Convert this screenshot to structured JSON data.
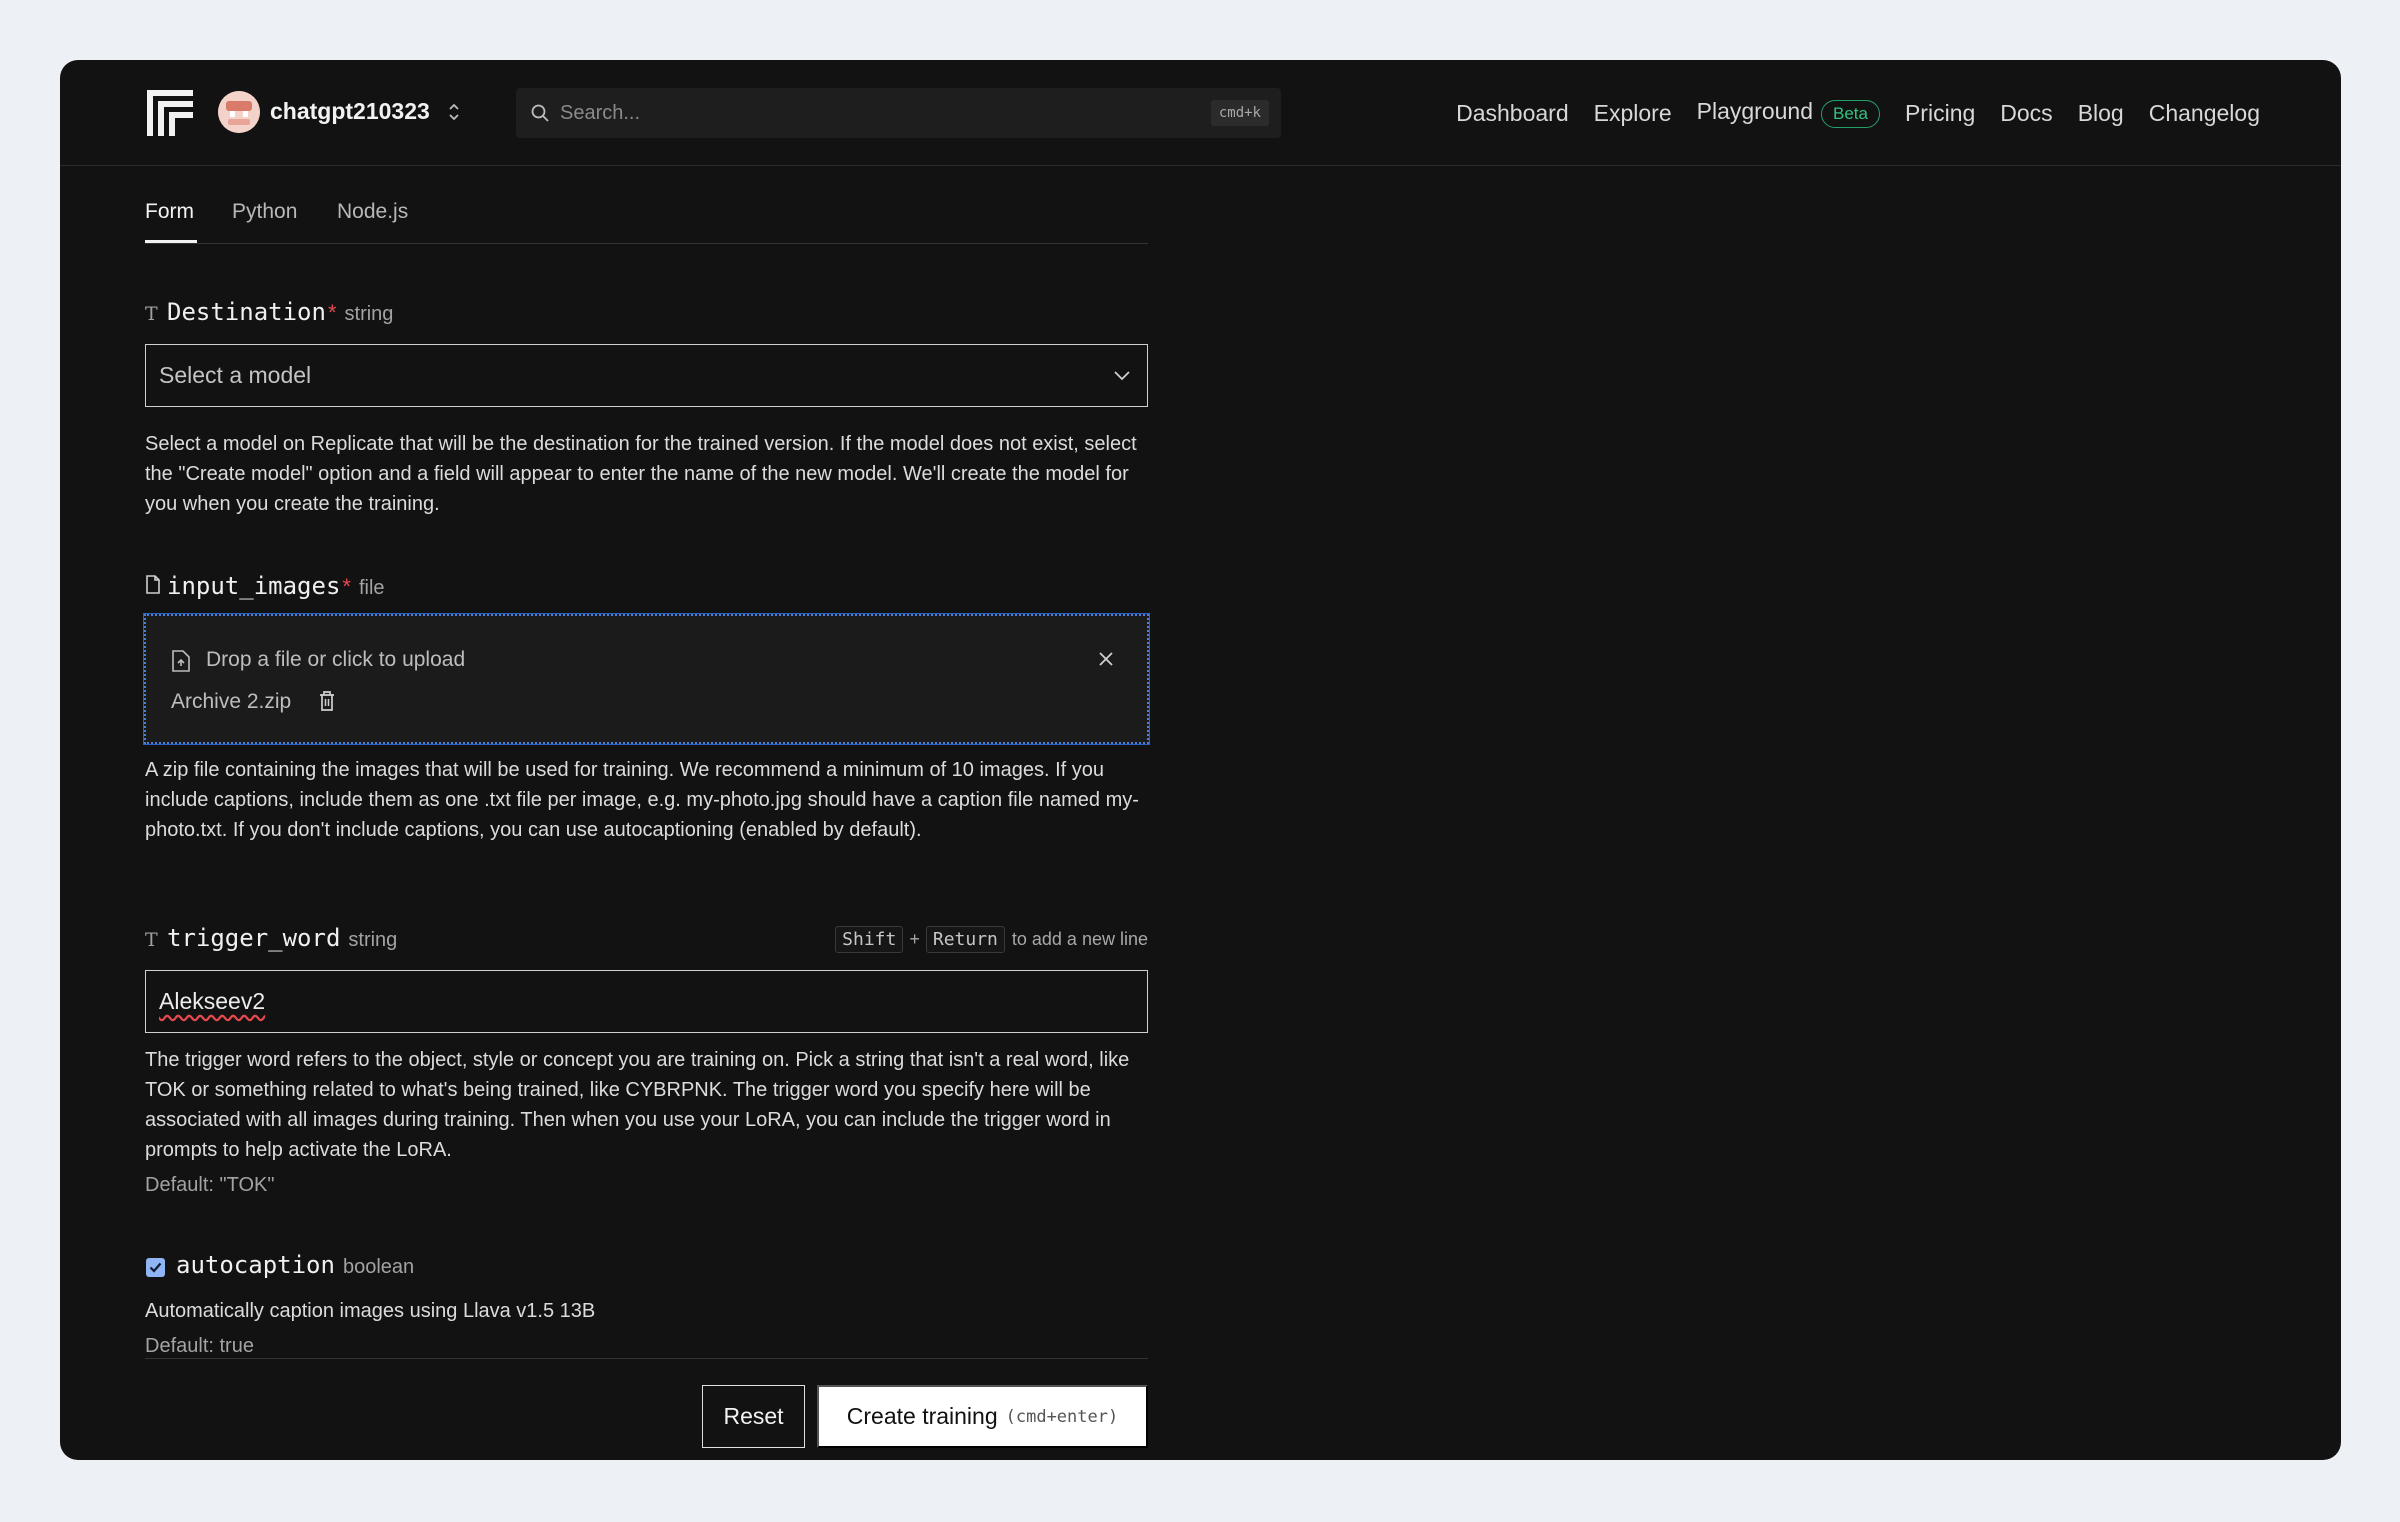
{
  "header": {
    "username": "chatgpt210323",
    "search_placeholder": "Search...",
    "search_shortcut": "cmd+k",
    "nav": {
      "dashboard": "Dashboard",
      "explore": "Explore",
      "playground": "Playground",
      "playground_badge": "Beta",
      "pricing": "Pricing",
      "docs": "Docs",
      "blog": "Blog",
      "changelog": "Changelog"
    }
  },
  "tabs": {
    "form": "Form",
    "python": "Python",
    "nodejs": "Node.js",
    "active": "Form"
  },
  "fields": {
    "destination": {
      "name": "Destination",
      "required_mark": "*",
      "type": "string",
      "type_glyph": "T",
      "placeholder": "Select a model",
      "description": "Select a model on Replicate that will be the destination for the trained version. If the model does not exist, select the \"Create model\" option and a field will appear to enter the name of the new model. We'll create the model for you when you create the training."
    },
    "input_images": {
      "name": "input_images",
      "required_mark": "*",
      "type": "file",
      "upload_prompt": "Drop a file or click to upload",
      "file_name": "Archive 2.zip",
      "description": "A zip file containing the images that will be used for training. We recommend a minimum of 10 images. If you include captions, include them as one .txt file per image, e.g. my-photo.jpg should have a caption file named my-photo.txt. If you don't include captions, you can use autocaptioning (enabled by default)."
    },
    "trigger_word": {
      "name": "trigger_word",
      "type": "string",
      "type_glyph": "T",
      "hint_key1": "Shift",
      "hint_plus": "+",
      "hint_key2": "Return",
      "hint_text": "to add a new line",
      "value": "Alekseev2",
      "description": "The trigger word refers to the object, style or concept you are training on. Pick a string that isn't a real word, like TOK or something related to what's being trained, like CYBRPNK. The trigger word you specify here will be associated with all images during training. Then when you use your LoRA, you can include the trigger word in prompts to help activate the LoRA.",
      "default": "Default: \"TOK\""
    },
    "autocaption": {
      "name": "autocaption",
      "type": "boolean",
      "checked": true,
      "description": "Automatically caption images using Llava v1.5 13B",
      "default": "Default: true"
    }
  },
  "actions": {
    "reset": "Reset",
    "create": "Create training",
    "create_shortcut": "(cmd+enter)"
  },
  "colors": {
    "page_bg": "#edf0f5",
    "window_bg": "#121212",
    "accent_green": "#34c17f",
    "required_red": "#e5484d",
    "focus_blue": "#4a7fe0"
  }
}
